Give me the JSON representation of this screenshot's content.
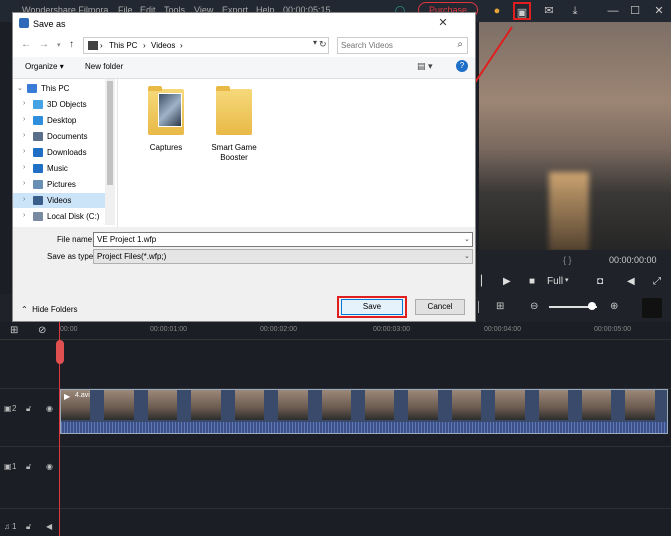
{
  "app": {
    "title": "Wondershare Filmora",
    "menus": [
      "File",
      "Edit",
      "Tools",
      "View",
      "Export",
      "Help"
    ],
    "timecode": "00:00:05:15",
    "purchase_label": "Purchase"
  },
  "preview": {
    "braces": "{      }",
    "timecode": "00:00:00:00",
    "quality": "Full"
  },
  "timeline": {
    "ruler": [
      "00:00",
      "00:00:01:00",
      "00:00:02:00",
      "00:00:03:00",
      "00:00:04:00",
      "00:00:05:00"
    ],
    "tracks": [
      {
        "label": "2"
      },
      {
        "label": "1"
      },
      {
        "label": "1"
      }
    ],
    "clip_name": "4.avi"
  },
  "dialog": {
    "title": "Save as",
    "address": {
      "segments": [
        "This PC",
        "Videos"
      ]
    },
    "search_placeholder": "Search Videos",
    "organize_label": "Organize",
    "new_folder_label": "New folder",
    "nav_items": [
      {
        "label": "This PC",
        "icon": "computer-icon",
        "color": "#3a7bd5"
      },
      {
        "label": "3D Objects",
        "icon": "cube-icon",
        "color": "#45a3e5"
      },
      {
        "label": "Desktop",
        "icon": "desktop-icon",
        "color": "#2f8fdc"
      },
      {
        "label": "Documents",
        "icon": "document-icon",
        "color": "#5a6f8a"
      },
      {
        "label": "Downloads",
        "icon": "download-icon",
        "color": "#1f6fc4"
      },
      {
        "label": "Music",
        "icon": "music-icon",
        "color": "#1f6fc4"
      },
      {
        "label": "Pictures",
        "icon": "picture-icon",
        "color": "#6a8fb5"
      },
      {
        "label": "Videos",
        "icon": "video-icon",
        "color": "#3a5e8a"
      },
      {
        "label": "Local Disk (C:)",
        "icon": "disk-icon",
        "color": "#7a8aa0"
      }
    ],
    "files": [
      {
        "label": "Captures"
      },
      {
        "label": "Smart Game Booster"
      }
    ],
    "file_name_label": "File name:",
    "file_name_value": "VE Project 1.wfp",
    "save_type_label": "Save as type:",
    "save_type_value": "Project Files(*.wfp;)",
    "hide_folders_label": "Hide Folders",
    "save_label": "Save",
    "cancel_label": "Cancel"
  },
  "colors": {
    "highlight_red": "#e01e1e",
    "playhead": "#e0363c",
    "selected_nav": "#cce4f7"
  }
}
